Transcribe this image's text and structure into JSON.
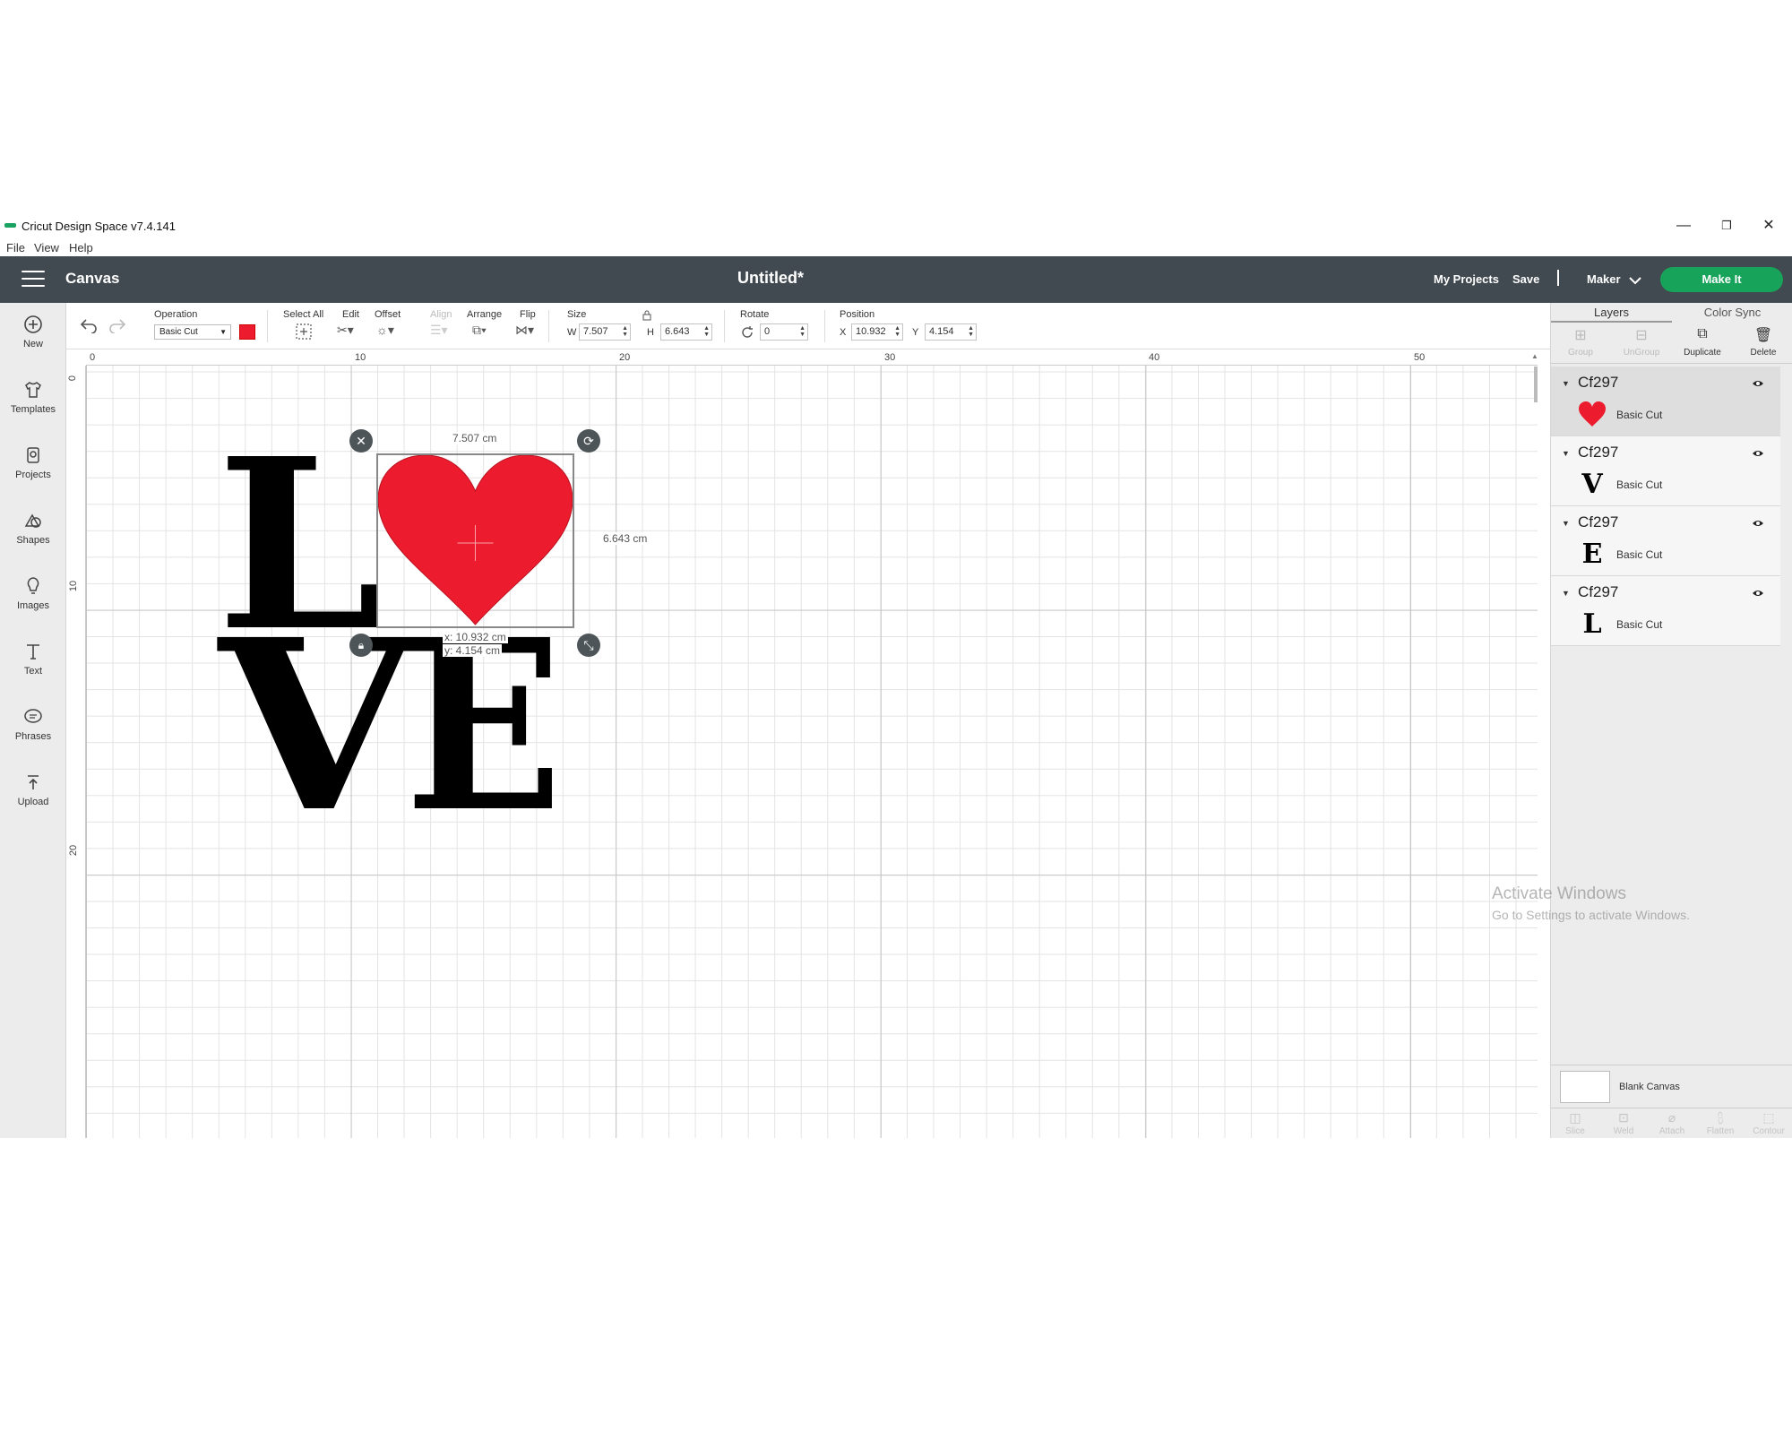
{
  "window": {
    "title": "Cricut Design Space  v7.4.141",
    "controls": {
      "minimize": "—",
      "restore": "❐",
      "close": "✕"
    }
  },
  "menu": [
    "File",
    "View",
    "Help"
  ],
  "header": {
    "section": "Canvas",
    "document_title": "Untitled*",
    "my_projects": "My Projects",
    "save": "Save",
    "separator": "|",
    "machine": "Maker",
    "make_it": "Make It",
    "accent_color": "#17a35a"
  },
  "leftrail": [
    {
      "label": "New",
      "icon": "plus-circle-icon"
    },
    {
      "label": "Templates",
      "icon": "shirt-icon"
    },
    {
      "label": "Projects",
      "icon": "projects-icon"
    },
    {
      "label": "Shapes",
      "icon": "shapes-icon"
    },
    {
      "label": "Images",
      "icon": "lightbulb-icon"
    },
    {
      "label": "Text",
      "icon": "text-icon"
    },
    {
      "label": "Phrases",
      "icon": "speech-bubble-icon"
    },
    {
      "label": "Upload",
      "icon": "upload-icon"
    }
  ],
  "toolbar": {
    "operation_label": "Operation",
    "operation_value": "Basic Cut",
    "operation_color": "#ec1c2e",
    "select_all": "Select All",
    "edit": "Edit",
    "offset": "Offset",
    "align": "Align",
    "arrange": "Arrange",
    "flip": "Flip",
    "size_label": "Size",
    "w_label": "W",
    "w_value": "7.507",
    "h_label": "H",
    "h_value": "6.643",
    "rotate_label": "Rotate",
    "rotate_value": "0",
    "position_label": "Position",
    "x_label": "X",
    "x_value": "10.932",
    "y_label": "Y",
    "y_value": "4.154"
  },
  "ruler": {
    "top": [
      "0",
      "10",
      "20",
      "30",
      "40",
      "50"
    ],
    "left": [
      "0",
      "10",
      "20"
    ]
  },
  "canvas": {
    "letters": [
      "L",
      "V",
      "E"
    ],
    "heart_color": "#ec1c2e",
    "selection": {
      "width_label": "7.507 cm",
      "height_label": "6.643 cm",
      "x_label": "x: 10.932 cm",
      "y_label": "y: 4.154 cm"
    }
  },
  "panel": {
    "tabs": [
      "Layers",
      "Color Sync"
    ],
    "tools": [
      "Group",
      "UnGroup",
      "Duplicate",
      "Delete"
    ],
    "layers": [
      {
        "group": "Cf297",
        "thumb": "heart",
        "name": "Basic Cut",
        "selected": true
      },
      {
        "group": "Cf297",
        "thumb": "V",
        "name": "Basic Cut",
        "selected": false
      },
      {
        "group": "Cf297",
        "thumb": "E",
        "name": "Basic Cut",
        "selected": false
      },
      {
        "group": "Cf297",
        "thumb": "L",
        "name": "Basic Cut",
        "selected": false
      }
    ],
    "blank_canvas": "Blank Canvas",
    "bottom_tools": [
      "Slice",
      "Weld",
      "Attach",
      "Flatten",
      "Contour"
    ]
  },
  "watermark": {
    "line1": "Activate Windows",
    "line2": "Go to Settings to activate Windows."
  }
}
